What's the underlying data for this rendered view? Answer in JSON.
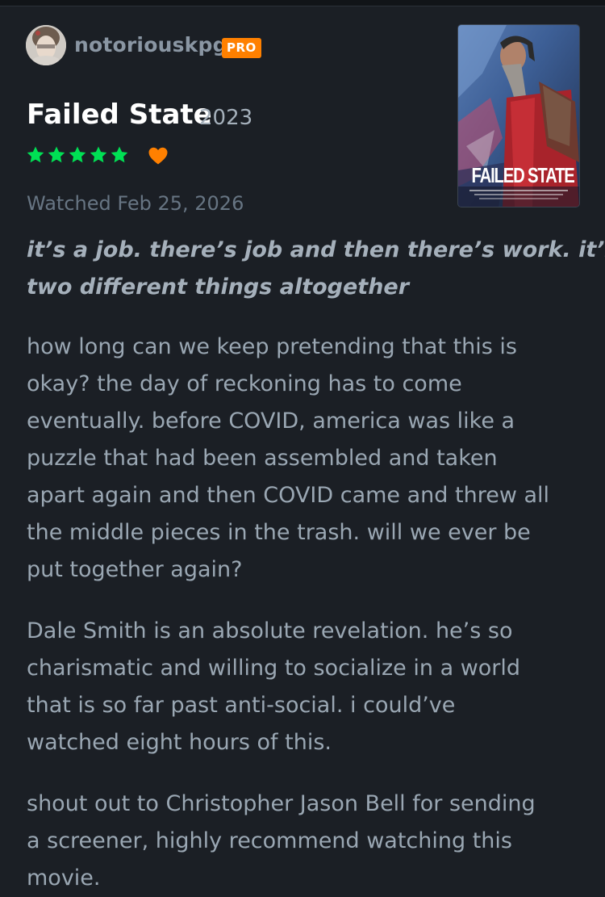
{
  "review": {
    "username": "notoriouskpg",
    "badge": "PRO",
    "film_title": "Failed State",
    "year": "2023",
    "rating_stars": 5,
    "liked": true,
    "watched_date": "Watched Feb 25, 2026",
    "poster_title": "FAILED STATE",
    "quote_lines": [
      "it’s a job. there’s job and then there’s work. it’s",
      "two different things altogether"
    ],
    "paragraphs": [
      {
        "lines": [
          "how long can we keep pretending that this is",
          "okay? the day of reckoning has to come",
          "eventually. before COVID, america was like a",
          "puzzle that had been assembled and taken",
          "apart again and then COVID came and threw all",
          "the middle pieces in the trash. will we ever be",
          "put together again?"
        ]
      },
      {
        "lines": [
          "Dale Smith is an absolute revelation. he’s so",
          "charismatic and willing to socialize in a world",
          "that is so far past anti-social. i could’ve",
          "watched eight hours of this."
        ]
      },
      {
        "lines": [
          "shout out to Christopher Jason Bell for sending",
          "a screener, highly recommend watching this",
          "movie."
        ]
      }
    ]
  },
  "colors": {
    "background": "#1b1f25",
    "star_green": "#00e054",
    "heart_orange": "#ff8000",
    "pro_badge": "#ff8000"
  },
  "icons": {
    "star": "star-icon",
    "heart": "heart-icon"
  }
}
